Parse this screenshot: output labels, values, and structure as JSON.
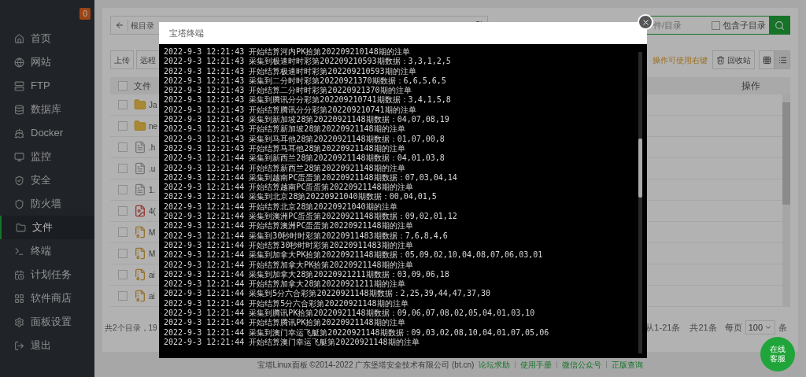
{
  "sidebar": {
    "badge": "0",
    "items": [
      {
        "label": "首页",
        "selected": false
      },
      {
        "label": "网站",
        "selected": false
      },
      {
        "label": "FTP",
        "selected": false
      },
      {
        "label": "数据库",
        "selected": false
      },
      {
        "label": "Docker",
        "selected": false
      },
      {
        "label": "监控",
        "selected": false
      },
      {
        "label": "安全",
        "selected": false
      },
      {
        "label": "防火墙",
        "selected": false
      },
      {
        "label": "文件",
        "selected": true
      },
      {
        "label": "终端",
        "selected": false
      },
      {
        "label": "计划任务",
        "selected": false
      },
      {
        "label": "软件商店",
        "selected": false
      },
      {
        "label": "面板设置",
        "selected": false
      },
      {
        "label": "退出",
        "selected": false
      }
    ]
  },
  "toolbar": {
    "path": "根目录",
    "search": {
      "placeholder": "件/目录"
    },
    "include_subdirs": {
      "label": "包含子目录",
      "checked": false
    }
  },
  "actions": {
    "buttons": [
      "上传",
      "远程"
    ],
    "hint": "操作可使用右键",
    "recycle": "回收站",
    "view_buttons": [
      {
        "selected": false
      },
      {
        "selected": true
      }
    ]
  },
  "table": {
    "columns": [
      "文件",
      "操作"
    ],
    "select_all": {
      "checked": false
    },
    "rows": [
      {
        "name": "Ja",
        "kind": "folder",
        "checked": false
      },
      {
        "name": "ne",
        "kind": "folder",
        "checked": false
      },
      {
        "name": ".h",
        "kind": "file",
        "checked": false
      },
      {
        "name": ".u",
        "kind": "file",
        "checked": false
      },
      {
        "name": "1.",
        "kind": "file",
        "checked": false
      },
      {
        "name": "4(",
        "kind": "image",
        "checked": false
      },
      {
        "name": "M",
        "kind": "archive",
        "checked": false
      },
      {
        "name": "M",
        "kind": "archive",
        "checked": false
      },
      {
        "name": "ai",
        "kind": "archive",
        "checked": false
      },
      {
        "name": "ai",
        "kind": "archive",
        "checked": false
      }
    ]
  },
  "summary": "共2个目录，19",
  "pagination": {
    "range": "从1-21条",
    "total": "共21条",
    "per_page_label": "每页",
    "per_page": "100",
    "unit": "条"
  },
  "footer": {
    "copyright": "宝塔Linux面板 ©2014-2022 广东堡塔安全技术有限公司 (bt.cn)",
    "links": [
      "论坛求助",
      "使用手册",
      "微信公众号",
      "正版查询"
    ]
  },
  "dialog": {
    "title": "宝塔终端",
    "lines": [
      "2022-9-3 12:21:43 开始结算河内PK拾第202209210148期的注单",
      "2022-9-3 12:21:43 采集到极速时时彩第202209210593期数据：3,3,1,2,5",
      "2022-9-3 12:21:43 开始结算极速时时彩第202209210593期的注单",
      "2022-9-3 12:21:43 采集到二分时时彩第20220921370期数据：6,6,5,6,5",
      "2022-9-3 12:21:43 开始结算二分时时彩第20220921370期的注单",
      "2022-9-3 12:21:43 采集到腾讯分分彩第202209210741期数据：3,4,1,5,8",
      "2022-9-3 12:21:43 开始结算腾讯分分彩第202209210741期的注单",
      "2022-9-3 12:21:43 采集到新加坡28第20220921148期数据：04,07,08,19",
      "2022-9-3 12:21:43 开始结算新加坡28第20220921148期的注单",
      "2022-9-3 12:21:43 采集到马耳他28第20220921148期数据：01,07,00,8",
      "2022-9-3 12:21:43 开始结算马耳他28第20220921148期的注单",
      "2022-9-3 12:21:44 采集到新西兰28第20220921148期数据：04,01,03,8",
      "2022-9-3 12:21:44 开始结算新西兰28第20220921148期的注单",
      "2022-9-3 12:21:44 采集到越南PC蛋蛋第20220921148期数据：07,03,04,14",
      "2022-9-3 12:21:44 开始结算越南PC蛋蛋第20220921148期的注单",
      "2022-9-3 12:21:44 采集到北京28第20220921040期数据：00,04,01,5",
      "2022-9-3 12:21:44 开始结算北京28第20220921040期的注单",
      "2022-9-3 12:21:44 采集到澳洲PC蛋蛋第20220921148期数据：09,02,01,12",
      "2022-9-3 12:21:44 开始结算澳洲PC蛋蛋第20220921148期的注单",
      "2022-9-3 12:21:44 采集到30秒时时彩第20220911483期数据：7,6,8,4,6",
      "2022-9-3 12:21:44 开始结算30秒时时彩第20220911483期的注单",
      "2022-9-3 12:21:44 采集到加拿大PK拾第20220921148期数据：05,09,02,10,04,08,07,06,03,01",
      "2022-9-3 12:21:44 开始结算加拿大PK拾第20220921148期的注单",
      "2022-9-3 12:21:44 采集到加拿大28第20220921211期数据：03,09,06,18",
      "2022-9-3 12:21:44 开始结算加拿大28第20220921211期的注单",
      "2022-9-3 12:21:44 采集到5分六合彩第20220921148期数据：2,25,39,44,47,37,30",
      "2022-9-3 12:21:44 开始结算5分六合彩第20220921148期的注单",
      "2022-9-3 12:21:44 采集到腾讯PK拾第20220921148期数据：09,06,07,08,02,05,04,01,03,10",
      "2022-9-3 12:21:44 开始结算腾讯PK拾第20220921148期的注单",
      "2022-9-3 12:21:44 采集到澳门幸运飞艇第20220921148期数据：09,03,02,08,10,04,01,07,05,06",
      "2022-9-3 12:21:44 开始结算澳门幸运飞艇第20220921148期的注单"
    ]
  },
  "chat_button": {
    "lines": [
      "在线",
      "客服"
    ]
  }
}
